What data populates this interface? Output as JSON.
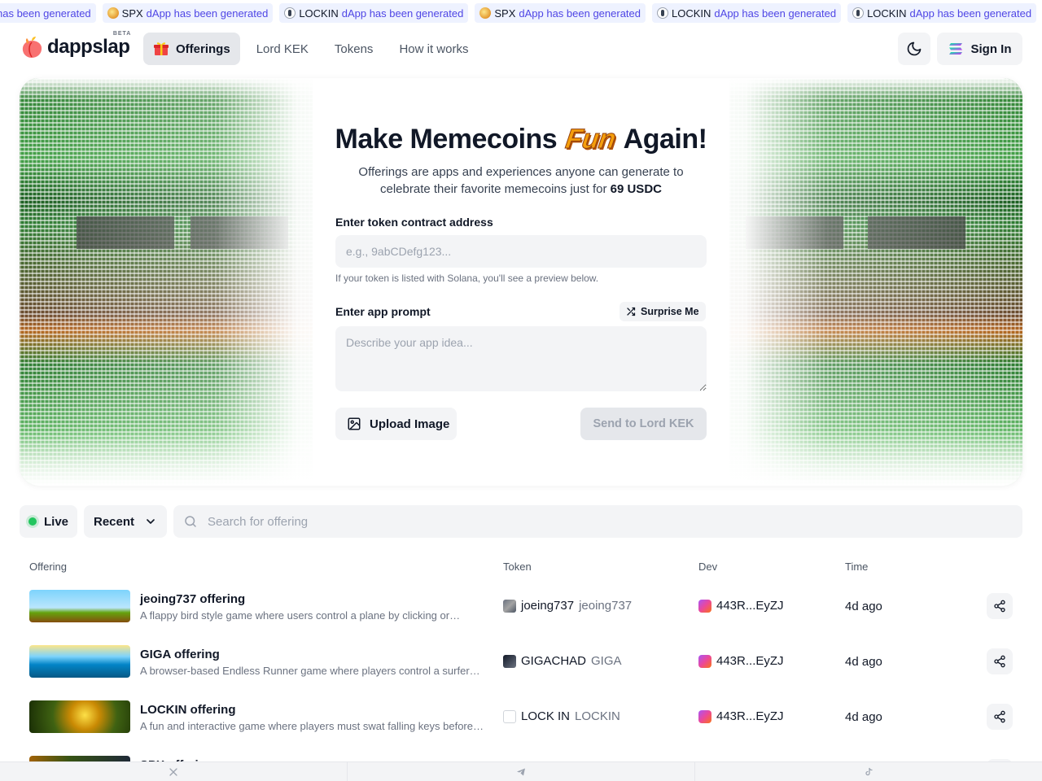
{
  "ticker": [
    {
      "token": "",
      "message": "has been generated",
      "coin": "none"
    },
    {
      "token": "SPX",
      "message": "dApp has been generated",
      "coin": "spx"
    },
    {
      "token": "LOCKIN",
      "message": "dApp has been generated",
      "coin": "lockin"
    },
    {
      "token": "SPX",
      "message": "dApp has been generated",
      "coin": "spx"
    },
    {
      "token": "LOCKIN",
      "message": "dApp has been generated",
      "coin": "lockin"
    },
    {
      "token": "LOCKIN",
      "message": "dApp has been generated",
      "coin": "lockin"
    }
  ],
  "header": {
    "logo": "dappslap",
    "beta": "BETA",
    "nav": [
      "Offerings",
      "Lord KEK",
      "Tokens",
      "How it works"
    ],
    "sign_in": "Sign In"
  },
  "hero": {
    "title_before": "Make Memecoins",
    "title_fun": "Fun",
    "title_after": "Again!",
    "subtitle": "Offerings are apps and experiences anyone can generate to celebrate their favorite memecoins just for",
    "price": "69 USDC",
    "contract_label": "Enter token contract address",
    "contract_placeholder": "e.g., 9abCDefg123...",
    "contract_hint": "If your token is listed with Solana, you'll see a preview below.",
    "prompt_label": "Enter app prompt",
    "surprise": "Surprise Me",
    "prompt_placeholder": "Describe your app idea...",
    "upload": "Upload Image",
    "send": "Send to Lord KEK"
  },
  "filters": {
    "live": "Live",
    "sort": "Recent",
    "search_placeholder": "Search for offering"
  },
  "table": {
    "headers": {
      "offering": "Offering",
      "token": "Token",
      "dev": "Dev",
      "time": "Time"
    },
    "rows": [
      {
        "title": "jeoing737 offering",
        "desc": "A flappy bird style game where users control a plane by clicking or…",
        "token": "joeing737",
        "symbol": "jeoing737",
        "dev": "443R...EyZJ",
        "time": "4d ago"
      },
      {
        "title": "GIGA offering",
        "desc": "A browser-based Endless Runner game where players control a surfer…",
        "token": "GIGACHAD",
        "symbol": "GIGA",
        "dev": "443R...EyZJ",
        "time": "4d ago"
      },
      {
        "title": "LOCKIN offering",
        "desc": "A fun and interactive game where players must swat falling keys before…",
        "token": "LOCK IN",
        "symbol": "LOCKIN",
        "dev": "443R...EyZJ",
        "time": "4d ago"
      },
      {
        "title": "SPX offering",
        "desc": "",
        "token": "",
        "symbol": "",
        "dev": "",
        "time": ""
      }
    ]
  },
  "footer": [
    "x-icon",
    "telegram-icon",
    "tiktok-icon"
  ]
}
